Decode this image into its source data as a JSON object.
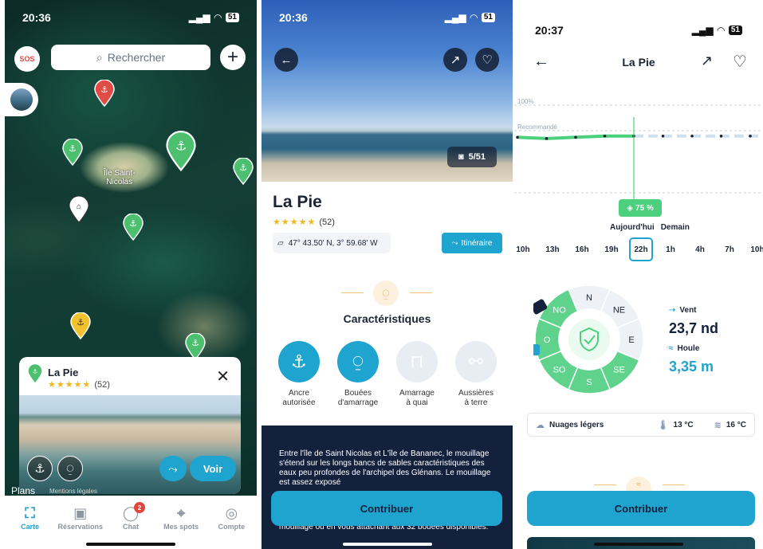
{
  "screen1": {
    "status": {
      "time": "20:36",
      "battery": "51"
    },
    "sos_label": "SOS",
    "search_placeholder": "Rechercher",
    "plus_label": "+",
    "island_label_line1": "Île Saint-",
    "island_label_line2": "Nicolas",
    "card": {
      "title": "La Pie",
      "stars": "★★★★★",
      "reviews": "(52)",
      "close": "✕",
      "voir": "Voir"
    },
    "plans": "Plans",
    "mentions": "Mentions légales",
    "tabs": [
      {
        "label": "Carte",
        "icon": "map-icon",
        "glyph": "⛶"
      },
      {
        "label": "Réservations",
        "icon": "calendar-icon",
        "glyph": "▣"
      },
      {
        "label": "Chat",
        "icon": "chat-icon",
        "glyph": "◯",
        "badge": "2"
      },
      {
        "label": "Mes spots",
        "icon": "location-icon",
        "glyph": "⌖"
      },
      {
        "label": "Compte",
        "icon": "account-icon",
        "glyph": "◎"
      }
    ],
    "colors": {
      "accent": "#1fa3cf",
      "pin_green": "#4cc06f",
      "pin_red": "#e04b45",
      "pin_yellow": "#f2c12e"
    }
  },
  "screen2": {
    "status": {
      "time": "20:36",
      "battery": "51"
    },
    "photo_count": "5/51",
    "title": "La Pie",
    "stars": "★★★★★",
    "reviews": "(52)",
    "coordinates": "47° 43.50' N, 3° 59.68' W",
    "itinerary": "Itinéraire",
    "section_title": "Caractéristiques",
    "features": [
      {
        "label_line1": "Ancre",
        "label_line2": "autorisée",
        "icon": "anchor-icon",
        "active": true
      },
      {
        "label_line1": "Bouées",
        "label_line2": "d'amarrage",
        "icon": "buoy-icon",
        "active": true
      },
      {
        "label_line1": "Amarrage",
        "label_line2": "à quai",
        "icon": "dock-icon",
        "active": false
      },
      {
        "label_line1": "Aussières",
        "label_line2": "à terre",
        "icon": "rope-icon",
        "active": false
      }
    ],
    "description": "Entre l'île de Saint Nicolas et L'île de Bananec, le mouillage s'étend sur les longs bancs de sables caractéristiques des eaux peu profondes de l'archipel des Glénans. Le mouillage est assez exposé",
    "description_tail": "mouillage ou en vous attachant aux 32 bouées disponibles.",
    "contribute": "Contribuer"
  },
  "screen3": {
    "status": {
      "time": "20:37",
      "battery": "51"
    },
    "title": "La Pie",
    "chart_data": {
      "type": "line",
      "y_label_top": "100%",
      "y_label_mid": "Recommandé",
      "series": [
        {
          "values": [
            74,
            73,
            74,
            75,
            75,
            75,
            75,
            75,
            75,
            75
          ]
        }
      ],
      "ylim": [
        0,
        100
      ],
      "selected_index": 4
    },
    "score": "75 %",
    "day_today": "Aujourd'hui",
    "day_tomorrow": "Demain",
    "hours": [
      "10h",
      "13h",
      "16h",
      "19h",
      "22h",
      "1h",
      "4h",
      "7h",
      "10h"
    ],
    "selected_hour": "22h",
    "compass": [
      "N",
      "NE",
      "E",
      "SE",
      "S",
      "SO",
      "O",
      "NO"
    ],
    "wind_label": "Vent",
    "wind_value": "23,7 nd",
    "swell_label": "Houle",
    "swell_value": "3,35 m",
    "weather": "Nuages légers",
    "air_temp": "13 °C",
    "water_temp": "16 °C",
    "contribute": "Contribuer"
  }
}
